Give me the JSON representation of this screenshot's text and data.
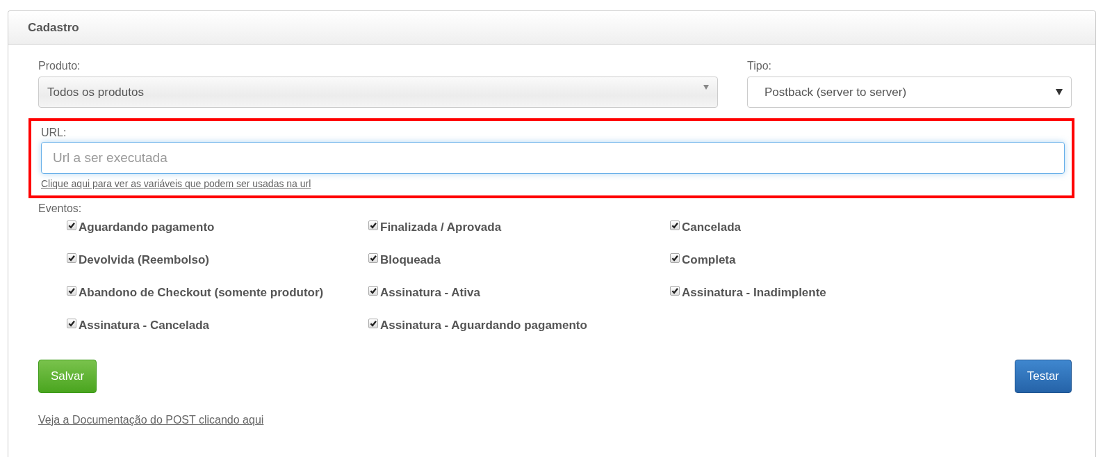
{
  "panel": {
    "title": "Cadastro"
  },
  "produto": {
    "label": "Produto:",
    "value": "Todos os produtos"
  },
  "tipo": {
    "label": "Tipo:",
    "value": "Postback (server to server)"
  },
  "url": {
    "label": "URL:",
    "placeholder": "Url a ser executada",
    "focused": true,
    "highlighted": true,
    "help_link": "Clique aqui para ver as variáveis que podem ser usadas na url"
  },
  "eventos": {
    "label": "Eventos:",
    "items": [
      {
        "label": "Aguardando pagamento",
        "checked": true
      },
      {
        "label": "Finalizada / Aprovada",
        "checked": true
      },
      {
        "label": "Cancelada",
        "checked": true
      },
      {
        "label": "Devolvida (Reembolso)",
        "checked": true
      },
      {
        "label": "Bloqueada",
        "checked": true
      },
      {
        "label": "Completa",
        "checked": true
      },
      {
        "label": "Abandono de Checkout (somente produtor)",
        "checked": true
      },
      {
        "label": "Assinatura - Ativa",
        "checked": true
      },
      {
        "label": "Assinatura - Inadimplente",
        "checked": true
      },
      {
        "label": "Assinatura - Cancelada",
        "checked": true
      },
      {
        "label": "Assinatura - Aguardando pagamento",
        "checked": true
      }
    ]
  },
  "buttons": [
    {
      "label": "Salvar",
      "kind": "success"
    },
    {
      "label": "Testar",
      "kind": "primary"
    }
  ],
  "doc_link": "Veja a Documentação do POST clicando aqui"
}
